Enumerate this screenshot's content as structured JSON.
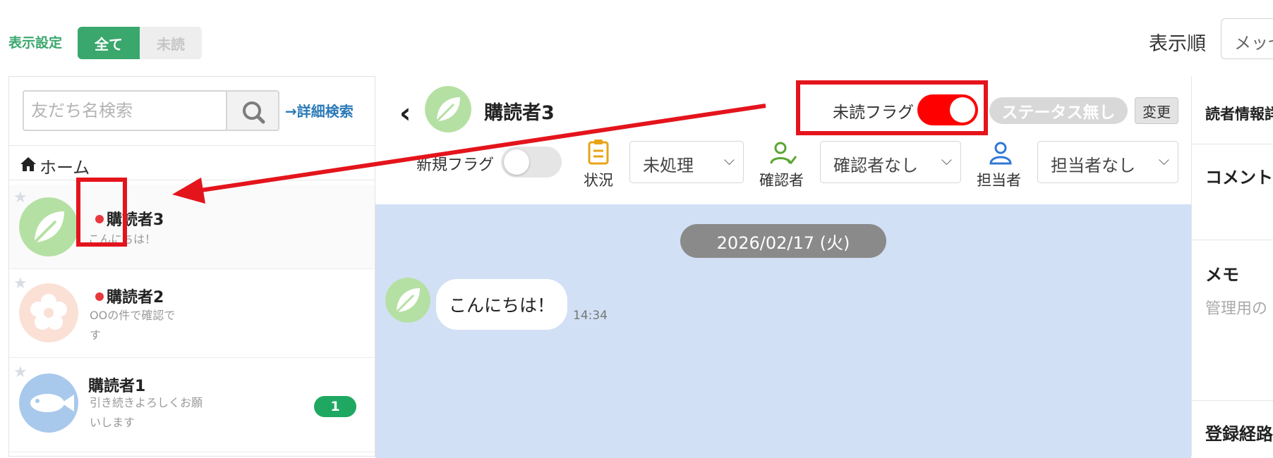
{
  "display_settings": {
    "label": "表示設定",
    "options": [
      "全て",
      "未読"
    ],
    "selected": "全て"
  },
  "sort": {
    "label": "表示順",
    "value": "メッセ"
  },
  "search": {
    "placeholder": "友だち名検索",
    "detail_link": "→詳細検索"
  },
  "home": {
    "label": "ホーム"
  },
  "contacts": [
    {
      "name": "購読者3",
      "preview": "こんにちは！",
      "unread_dot": true
    },
    {
      "name": "購読者2",
      "preview_line1": "OOの件で確認で",
      "preview_line2": "す",
      "unread_dot": true
    },
    {
      "name": "購読者1",
      "preview_line1": "引き続きよろしくお願",
      "preview_line2": "いします",
      "badge": "1"
    }
  ],
  "chat": {
    "name": "購読者3",
    "unread_flag": {
      "label": "未読フラグ",
      "on": true
    },
    "status": "ステータス無し",
    "change": "変更",
    "new_flag": {
      "label": "新規フラグ",
      "on": false
    },
    "status_caption": "状況",
    "status_select": "未処理",
    "confirmer_caption": "確認者",
    "confirmer_select": "確認者なし",
    "assignee_caption": "担当者",
    "assignee_select": "担当者なし",
    "date": "2026/02/17 (火)",
    "message": "こんにちは！",
    "time": "14:34"
  },
  "right_panel": {
    "reader_info": "読者情報詳",
    "comment": "コメント",
    "memo": "メモ",
    "memo_placeholder": "管理用の",
    "registration": "登録経路"
  },
  "colors": {
    "green": "#3aa76d",
    "red_annotation": "#e4141c",
    "chat_bg": "#d2e0f5",
    "toggle_on": "#ff0000"
  }
}
